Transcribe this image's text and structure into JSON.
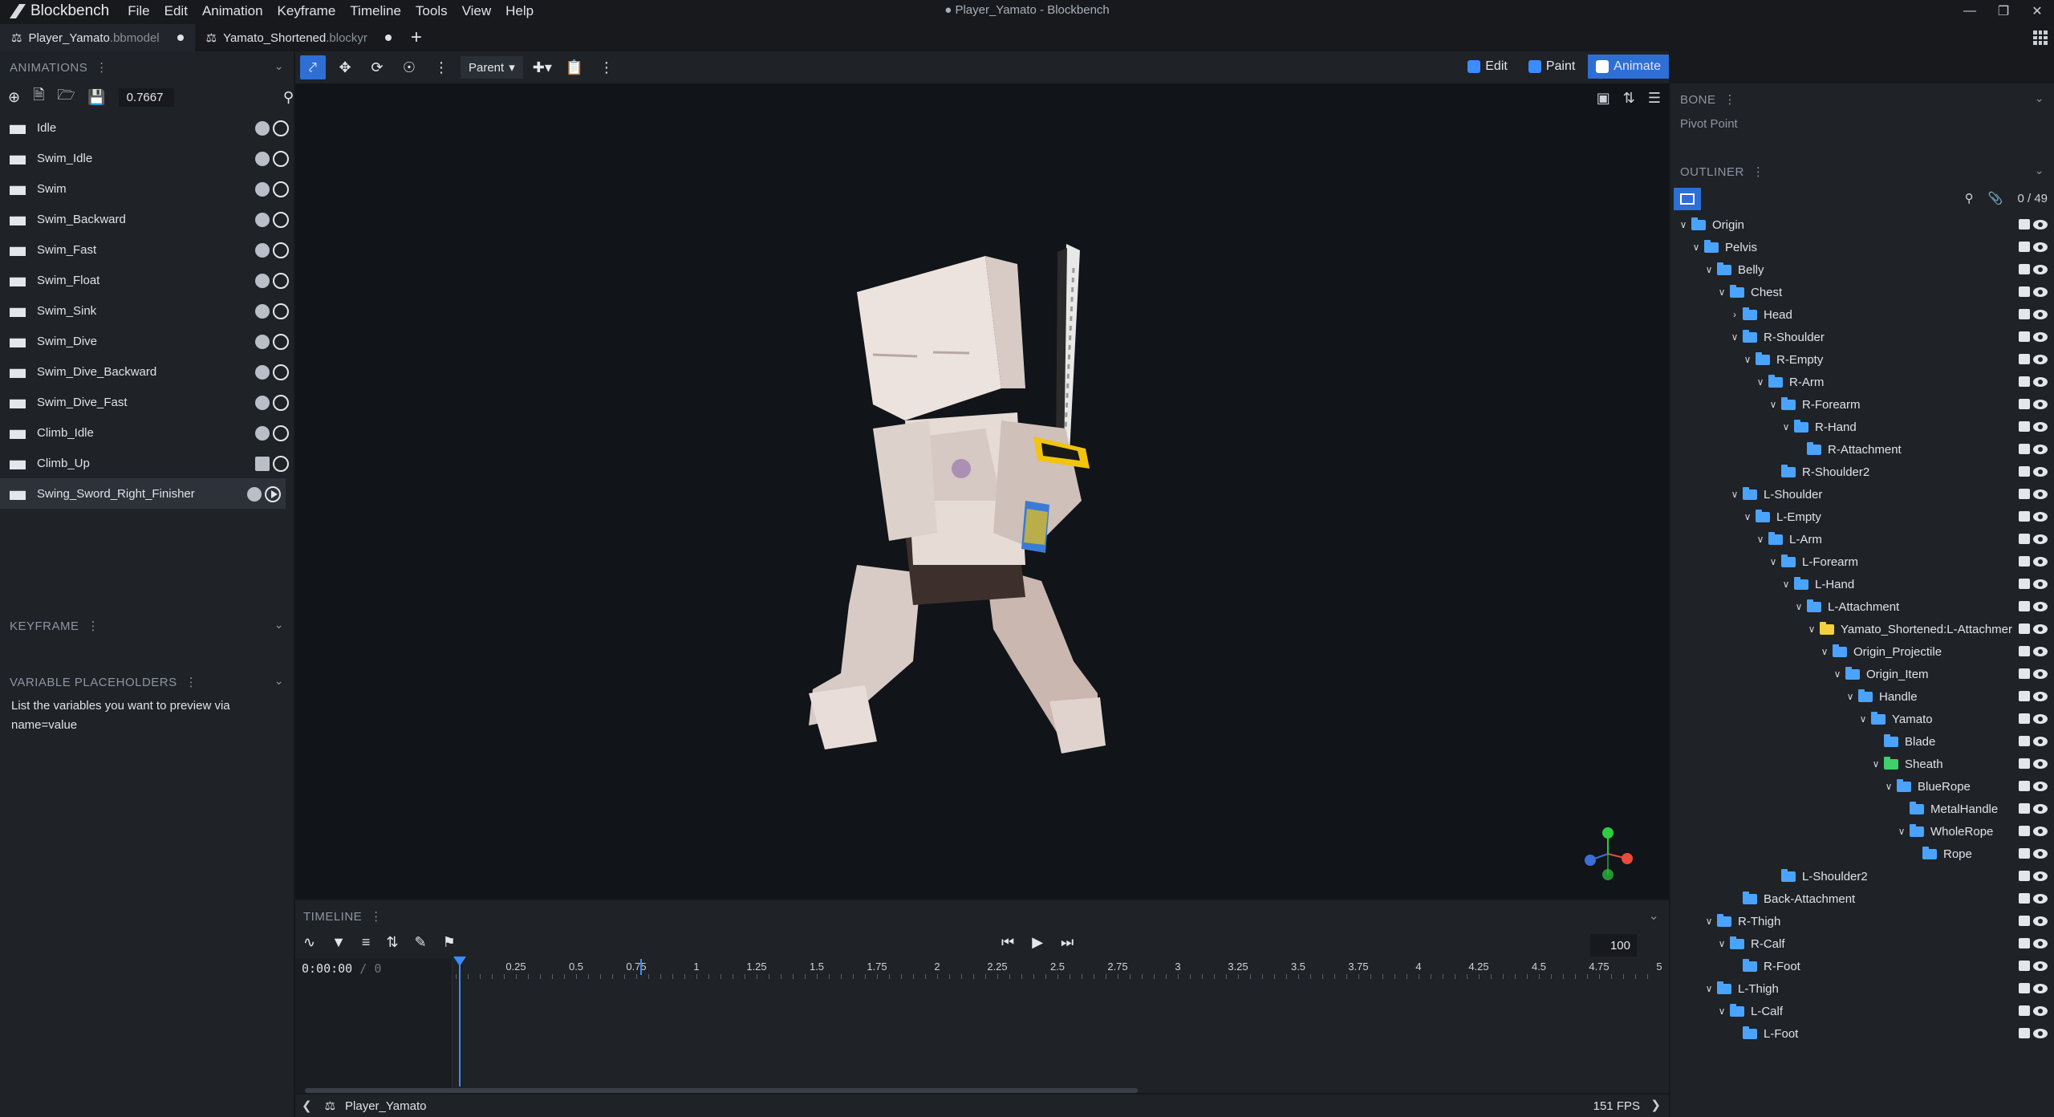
{
  "app": {
    "name": "Blockbench",
    "window_title": "● Player_Yamato - Blockbench",
    "menu": [
      "File",
      "Edit",
      "Animation",
      "Keyframe",
      "Timeline",
      "Tools",
      "View",
      "Help"
    ]
  },
  "tabs": [
    {
      "name": "Player_Yamato",
      "ext": ".bbmodel"
    },
    {
      "name": "Yamato_Shortened",
      "ext": ".blockyr"
    }
  ],
  "toolbar": {
    "pivot_mode": "Parent"
  },
  "modes": [
    "Edit",
    "Paint",
    "Animate"
  ],
  "animations_panel": {
    "title": "ANIMATIONS",
    "time_value": "0.7667",
    "items": [
      {
        "label": "Idle"
      },
      {
        "label": "Swim_Idle"
      },
      {
        "label": "Swim"
      },
      {
        "label": "Swim_Backward"
      },
      {
        "label": "Swim_Fast"
      },
      {
        "label": "Swim_Float"
      },
      {
        "label": "Swim_Sink"
      },
      {
        "label": "Swim_Dive"
      },
      {
        "label": "Swim_Dive_Backward"
      },
      {
        "label": "Swim_Dive_Fast"
      },
      {
        "label": "Climb_Idle"
      },
      {
        "label": "Climb_Up"
      },
      {
        "label": "Swing_Sword_Right_Finisher"
      }
    ]
  },
  "keyframe_panel": {
    "title": "KEYFRAME"
  },
  "variable_panel": {
    "title": "VARIABLE PLACEHOLDERS",
    "text": "List the variables you want to preview via name=value"
  },
  "timeline": {
    "title": "TIMELINE",
    "time": "0:00:00",
    "frame": "0",
    "speed": "100",
    "ticks": [
      "0.25",
      "0.5",
      "0.75",
      "1",
      "1.25",
      "1.5",
      "1.75",
      "2",
      "2.25",
      "2.5",
      "2.75",
      "3",
      "3.25",
      "3.5",
      "3.75",
      "4",
      "4.25",
      "4.5",
      "4.75",
      "5"
    ]
  },
  "status": {
    "model": "Player_Yamato",
    "fps": "151 FPS"
  },
  "bone_panel": {
    "title": "BONE",
    "pivot_label": "Pivot Point"
  },
  "outliner": {
    "title": "OUTLINER",
    "count": "0 / 49",
    "nodes": [
      {
        "label": "Origin",
        "depth": 0,
        "arrow": "open"
      },
      {
        "label": "Pelvis",
        "depth": 1,
        "arrow": "open"
      },
      {
        "label": "Belly",
        "depth": 2,
        "arrow": "open"
      },
      {
        "label": "Chest",
        "depth": 3,
        "arrow": "open"
      },
      {
        "label": "Head",
        "depth": 4,
        "arrow": "closed"
      },
      {
        "label": "R-Shoulder",
        "depth": 4,
        "arrow": "open"
      },
      {
        "label": "R-Empty",
        "depth": 5,
        "arrow": "open"
      },
      {
        "label": "R-Arm",
        "depth": 6,
        "arrow": "open"
      },
      {
        "label": "R-Forearm",
        "depth": 7,
        "arrow": "open"
      },
      {
        "label": "R-Hand",
        "depth": 8,
        "arrow": "open"
      },
      {
        "label": "R-Attachment",
        "depth": 9,
        "arrow": "none"
      },
      {
        "label": "R-Shoulder2",
        "depth": 7,
        "arrow": "none"
      },
      {
        "label": "L-Shoulder",
        "depth": 4,
        "arrow": "open"
      },
      {
        "label": "L-Empty",
        "depth": 5,
        "arrow": "open"
      },
      {
        "label": "L-Arm",
        "depth": 6,
        "arrow": "open"
      },
      {
        "label": "L-Forearm",
        "depth": 7,
        "arrow": "open"
      },
      {
        "label": "L-Hand",
        "depth": 8,
        "arrow": "open"
      },
      {
        "label": "L-Attachment",
        "depth": 9,
        "arrow": "open"
      },
      {
        "label": "Yamato_Shortened:L-Attachmer",
        "depth": 10,
        "arrow": "open",
        "color": "yellow"
      },
      {
        "label": "Origin_Projectile",
        "depth": 11,
        "arrow": "open"
      },
      {
        "label": "Origin_Item",
        "depth": 12,
        "arrow": "open"
      },
      {
        "label": "Handle",
        "depth": 13,
        "arrow": "open"
      },
      {
        "label": "Yamato",
        "depth": 14,
        "arrow": "open"
      },
      {
        "label": "Blade",
        "depth": 15,
        "arrow": "none"
      },
      {
        "label": "Sheath",
        "depth": 15,
        "arrow": "open",
        "color": "green"
      },
      {
        "label": "BlueRope",
        "depth": 16,
        "arrow": "open"
      },
      {
        "label": "MetalHandle",
        "depth": 17,
        "arrow": "none"
      },
      {
        "label": "WholeRope",
        "depth": 17,
        "arrow": "open"
      },
      {
        "label": "Rope",
        "depth": 18,
        "arrow": "none"
      },
      {
        "label": "L-Shoulder2",
        "depth": 7,
        "arrow": "none"
      },
      {
        "label": "Back-Attachment",
        "depth": 4,
        "arrow": "none"
      },
      {
        "label": "R-Thigh",
        "depth": 2,
        "arrow": "open"
      },
      {
        "label": "R-Calf",
        "depth": 3,
        "arrow": "open"
      },
      {
        "label": "R-Foot",
        "depth": 4,
        "arrow": "none"
      },
      {
        "label": "L-Thigh",
        "depth": 2,
        "arrow": "open"
      },
      {
        "label": "L-Calf",
        "depth": 3,
        "arrow": "open"
      },
      {
        "label": "L-Foot",
        "depth": 4,
        "arrow": "none"
      }
    ]
  }
}
